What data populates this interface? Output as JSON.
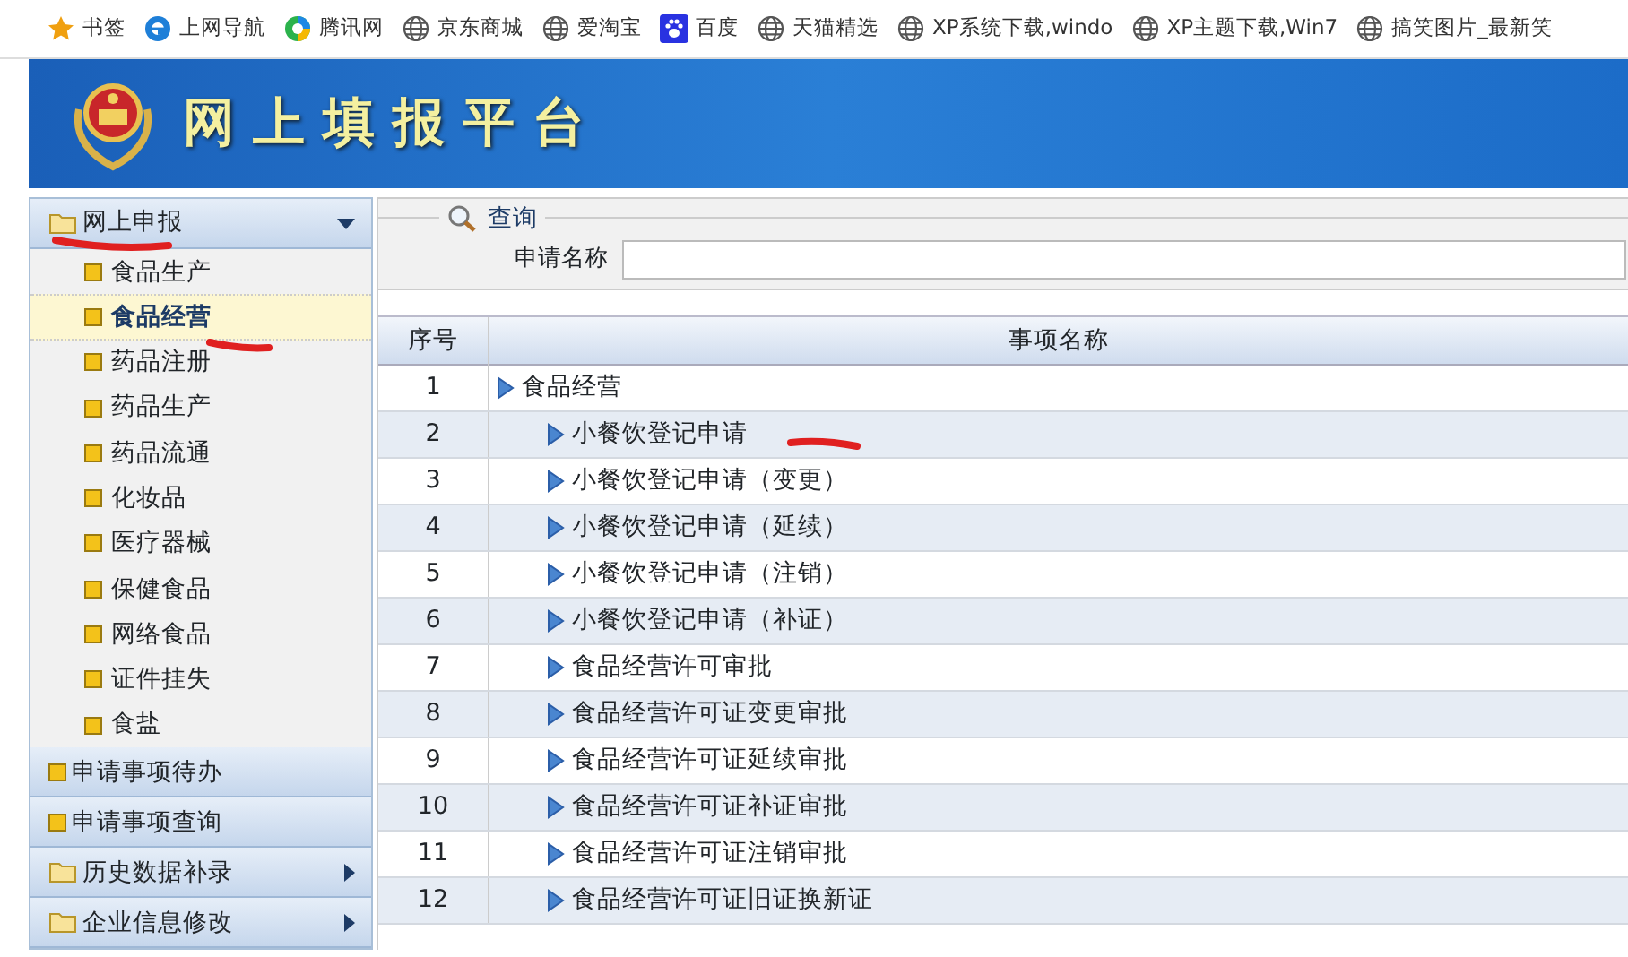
{
  "bookmarks": [
    {
      "label": "书签",
      "kind": "star"
    },
    {
      "label": "上网导航",
      "kind": "ie"
    },
    {
      "label": "腾讯网",
      "kind": "swirl"
    },
    {
      "label": "京东商城",
      "kind": "globe"
    },
    {
      "label": "爱淘宝",
      "kind": "globe"
    },
    {
      "label": "百度",
      "kind": "paw"
    },
    {
      "label": "天猫精选",
      "kind": "globe"
    },
    {
      "label": "XP系统下载,windo",
      "kind": "globe"
    },
    {
      "label": "XP主题下载,Win7",
      "kind": "globe"
    },
    {
      "label": "搞笑图片_最新笑",
      "kind": "globe"
    }
  ],
  "header": {
    "title": "网上填报平台"
  },
  "sidebar": {
    "sections": [
      {
        "label": "网上申报",
        "kind": "folder",
        "expanded": true,
        "items": [
          {
            "label": "食品生产",
            "selected": false
          },
          {
            "label": "食品经营",
            "selected": true
          },
          {
            "label": "药品注册",
            "selected": false
          },
          {
            "label": "药品生产",
            "selected": false
          },
          {
            "label": "药品流通",
            "selected": false
          },
          {
            "label": "化妆品",
            "selected": false
          },
          {
            "label": "医疗器械",
            "selected": false
          },
          {
            "label": "保健食品",
            "selected": false
          },
          {
            "label": "网络食品",
            "selected": false
          },
          {
            "label": "证件挂失",
            "selected": false
          },
          {
            "label": "食盐",
            "selected": false
          }
        ]
      },
      {
        "label": "申请事项待办",
        "kind": "leaf"
      },
      {
        "label": "申请事项查询",
        "kind": "leaf"
      },
      {
        "label": "历史数据补录",
        "kind": "folder",
        "expanded": false
      },
      {
        "label": "企业信息修改",
        "kind": "folder",
        "expanded": false
      }
    ]
  },
  "query": {
    "legend": "查询",
    "field_label": "申请名称"
  },
  "table": {
    "columns": [
      "序号",
      "事项名称"
    ],
    "rows": [
      {
        "no": "1",
        "name": "食品经营",
        "children": [
          {
            "no": "2",
            "name": "小餐饮登记申请"
          },
          {
            "no": "3",
            "name": "小餐饮登记申请（变更）"
          },
          {
            "no": "4",
            "name": "小餐饮登记申请（延续）"
          },
          {
            "no": "5",
            "name": "小餐饮登记申请（注销）"
          },
          {
            "no": "6",
            "name": "小餐饮登记申请（补证）"
          },
          {
            "no": "7",
            "name": "食品经营许可审批"
          },
          {
            "no": "8",
            "name": "食品经营许可证变更审批"
          },
          {
            "no": "9",
            "name": "食品经营许可证延续审批"
          },
          {
            "no": "10",
            "name": "食品经营许可证补证审批"
          },
          {
            "no": "11",
            "name": "食品经营许可证注销审批"
          },
          {
            "no": "12",
            "name": "食品经营许可证旧证换新证"
          }
        ]
      }
    ]
  }
}
